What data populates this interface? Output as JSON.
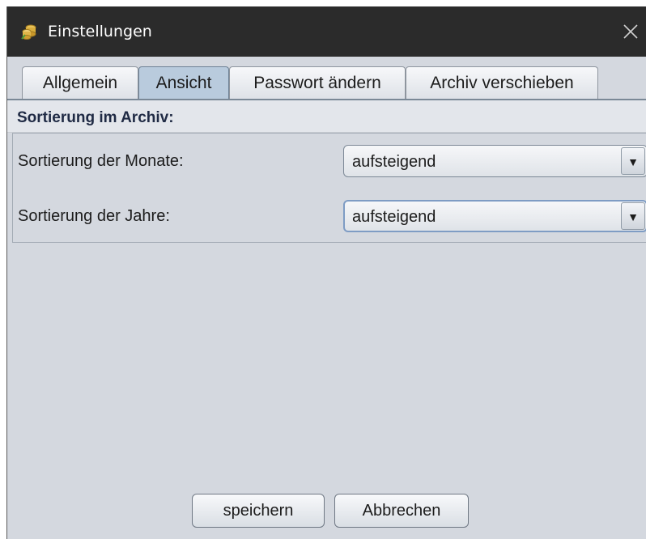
{
  "window": {
    "title": "Einstellungen",
    "icon": "coins-icon",
    "close_icon": "close-icon"
  },
  "tabs": [
    {
      "label": "Allgemein",
      "active": false
    },
    {
      "label": "Ansicht",
      "active": true
    },
    {
      "label": "Passwort ändern",
      "active": false
    },
    {
      "label": "Archiv verschieben",
      "active": false
    }
  ],
  "section": {
    "title": "Sortierung im Archiv:"
  },
  "settings": {
    "months_label": "Sortierung der Monate:",
    "months_value": "aufsteigend",
    "years_label": "Sortierung der Jahre:",
    "years_value": "aufsteigend"
  },
  "buttons": {
    "save": "speichern",
    "cancel": "Abbrechen"
  },
  "colors": {
    "titlebar": "#2b2b2b",
    "panel": "#d4d8df",
    "active_tab": "#b9cbdd"
  }
}
